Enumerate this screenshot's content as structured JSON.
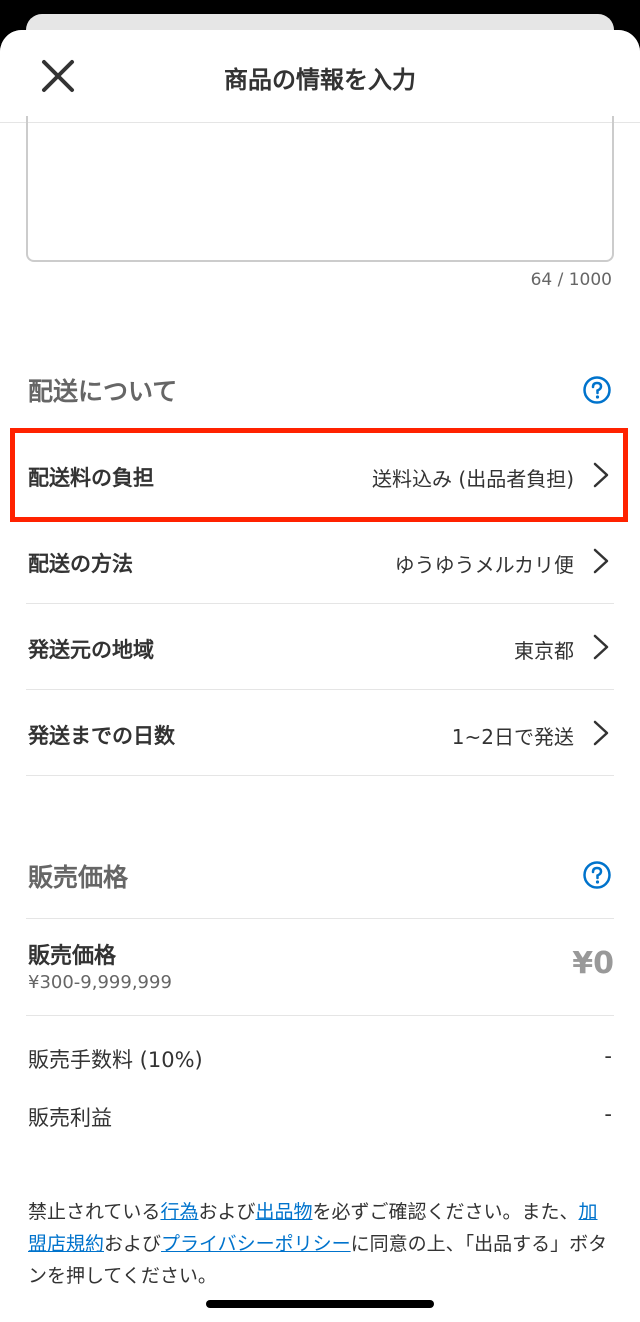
{
  "header": {
    "title": "商品の情報を入力"
  },
  "description": {
    "char_count": "64 / 1000"
  },
  "shipping": {
    "section_title": "配送について",
    "rows": [
      {
        "label": "配送料の負担",
        "value": "送料込み (出品者負担)"
      },
      {
        "label": "配送の方法",
        "value": "ゆうゆうメルカリ便"
      },
      {
        "label": "発送元の地域",
        "value": "東京都"
      },
      {
        "label": "発送までの日数",
        "value": "1~2日で発送"
      }
    ]
  },
  "price": {
    "section_title": "販売価格",
    "label": "販売価格",
    "range": "¥300-9,999,999",
    "value": "¥0",
    "fee_label": "販売手数料 (10%)",
    "fee_value": "-",
    "profit_label": "販売利益",
    "profit_value": "-"
  },
  "notice": {
    "part1": "禁止されている",
    "link1": "行為",
    "part2": "および",
    "link2": "出品物",
    "part3": "を必ずご確認ください。また、",
    "link3": "加盟店規約",
    "part4": "および",
    "link4": "プライバシーポリシー",
    "part5": "に同意の上、「出品する」ボタンを押してください。"
  },
  "colors": {
    "accent_link": "#0073cc",
    "highlight": "#ff2200",
    "help_icon": "#0073cc"
  },
  "icons": {
    "close": "close-icon",
    "help": "help-icon",
    "chevron": "chevron-right-icon"
  }
}
